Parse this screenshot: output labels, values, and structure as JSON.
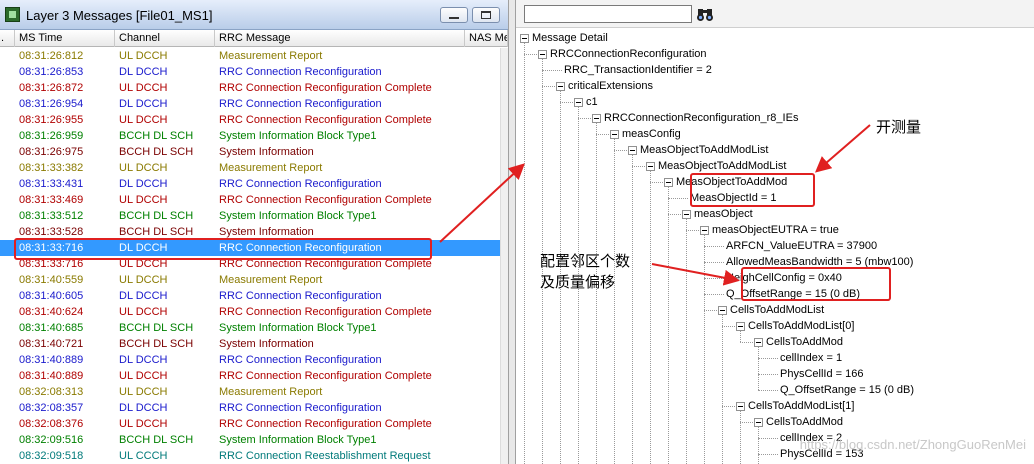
{
  "left_window": {
    "title": "Layer 3 Messages [File01_MS1]",
    "columns": [
      ".",
      "MS Time",
      "Channel",
      "RRC Message",
      "NAS Mes"
    ],
    "rows": [
      {
        "time": "08:31:26:812",
        "channel": "UL DCCH",
        "message": "Measurement Report",
        "color": "#8a7a00"
      },
      {
        "time": "08:31:26:853",
        "channel": "DL DCCH",
        "message": "RRC Connection Reconfiguration",
        "color": "#1a1acc"
      },
      {
        "time": "08:31:26:872",
        "channel": "UL DCCH",
        "message": "RRC Connection Reconfiguration Complete",
        "color": "#b00000"
      },
      {
        "time": "08:31:26:954",
        "channel": "DL DCCH",
        "message": "RRC Connection Reconfiguration",
        "color": "#1a1acc"
      },
      {
        "time": "08:31:26:955",
        "channel": "UL DCCH",
        "message": "RRC Connection Reconfiguration Complete",
        "color": "#b00000"
      },
      {
        "time": "08:31:26:959",
        "channel": "BCCH DL SCH",
        "message": "System Information Block Type1",
        "color": "#008000"
      },
      {
        "time": "08:31:26:975",
        "channel": "BCCH DL SCH",
        "message": "System Information",
        "color": "#7a0000"
      },
      {
        "time": "08:31:33:382",
        "channel": "UL DCCH",
        "message": "Measurement Report",
        "color": "#8a7a00"
      },
      {
        "time": "08:31:33:431",
        "channel": "DL DCCH",
        "message": "RRC Connection Reconfiguration",
        "color": "#1a1acc"
      },
      {
        "time": "08:31:33:469",
        "channel": "UL DCCH",
        "message": "RRC Connection Reconfiguration Complete",
        "color": "#b00000"
      },
      {
        "time": "08:31:33:512",
        "channel": "BCCH DL SCH",
        "message": "System Information Block Type1",
        "color": "#008000"
      },
      {
        "time": "08:31:33:528",
        "channel": "BCCH DL SCH",
        "message": "System Information",
        "color": "#7a0000"
      },
      {
        "time": "08:31:33:716",
        "channel": "DL DCCH",
        "message": "RRC Connection Reconfiguration",
        "color": "#1a1acc",
        "selected": true
      },
      {
        "time": "08:31:33:716",
        "channel": "UL DCCH",
        "message": "RRC Connection Reconfiguration Complete",
        "color": "#b00000"
      },
      {
        "time": "08:31:40:559",
        "channel": "UL DCCH",
        "message": "Measurement Report",
        "color": "#8a7a00"
      },
      {
        "time": "08:31:40:605",
        "channel": "DL DCCH",
        "message": "RRC Connection Reconfiguration",
        "color": "#1a1acc"
      },
      {
        "time": "08:31:40:624",
        "channel": "UL DCCH",
        "message": "RRC Connection Reconfiguration Complete",
        "color": "#b00000"
      },
      {
        "time": "08:31:40:685",
        "channel": "BCCH DL SCH",
        "message": "System Information Block Type1",
        "color": "#008000"
      },
      {
        "time": "08:31:40:721",
        "channel": "BCCH DL SCH",
        "message": "System Information",
        "color": "#7a0000"
      },
      {
        "time": "08:31:40:889",
        "channel": "DL DCCH",
        "message": "RRC Connection Reconfiguration",
        "color": "#1a1acc"
      },
      {
        "time": "08:31:40:889",
        "channel": "UL DCCH",
        "message": "RRC Connection Reconfiguration Complete",
        "color": "#b00000"
      },
      {
        "time": "08:32:08:313",
        "channel": "UL DCCH",
        "message": "Measurement Report",
        "color": "#8a7a00"
      },
      {
        "time": "08:32:08:357",
        "channel": "DL DCCH",
        "message": "RRC Connection Reconfiguration",
        "color": "#1a1acc"
      },
      {
        "time": "08:32:08:376",
        "channel": "UL DCCH",
        "message": "RRC Connection Reconfiguration Complete",
        "color": "#b00000"
      },
      {
        "time": "08:32:09:516",
        "channel": "BCCH DL SCH",
        "message": "System Information Block Type1",
        "color": "#008000"
      },
      {
        "time": "08:32:09:518",
        "channel": "UL CCCH",
        "message": "RRC Connection Reestablishment Request",
        "color": "#007a7a"
      }
    ]
  },
  "right_window": {
    "search_value": "",
    "find_icon": "binoculars-icon",
    "tree": [
      {
        "text": "Message Detail",
        "level": 0
      },
      {
        "text": "RRCConnectionReconfiguration",
        "level": 1
      },
      {
        "text": "RRC_TransactionIdentifier = 2",
        "level": 2
      },
      {
        "text": "criticalExtensions",
        "level": 2
      },
      {
        "text": "c1",
        "level": 3
      },
      {
        "text": "RRCConnectionReconfiguration_r8_IEs",
        "level": 4
      },
      {
        "text": "measConfig",
        "level": 5
      },
      {
        "text": "MeasObjectToAddModList",
        "level": 6
      },
      {
        "text": "MeasObjectToAddModList",
        "level": 7
      },
      {
        "text": "MeasObjectToAddMod",
        "level": 8
      },
      {
        "text": "MeasObjectId = 1",
        "level": 9
      },
      {
        "text": "measObject",
        "level": 9
      },
      {
        "text": "measObjectEUTRA = true",
        "level": 10
      },
      {
        "text": "ARFCN_ValueEUTRA = 37900",
        "level": 11
      },
      {
        "text": "AllowedMeasBandwidth = 5 (mbw100)",
        "level": 11
      },
      {
        "text": "NeighCellConfig = 0x40",
        "level": 11
      },
      {
        "text": "Q_OffsetRange = 15 (0 dB)",
        "level": 11
      },
      {
        "text": "CellsToAddModList",
        "level": 11
      },
      {
        "text": "CellsToAddModList[0]",
        "level": 12
      },
      {
        "text": "CellsToAddMod",
        "level": 13
      },
      {
        "text": "cellIndex = 1",
        "level": 14
      },
      {
        "text": "PhysCellId = 166",
        "level": 14
      },
      {
        "text": "Q_OffsetRange = 15 (0 dB)",
        "level": 14
      },
      {
        "text": "CellsToAddModList[1]",
        "level": 12
      },
      {
        "text": "CellsToAddMod",
        "level": 13
      },
      {
        "text": "cellIndex = 2",
        "level": 14
      },
      {
        "text": "PhysCellId = 153",
        "level": 14
      }
    ]
  },
  "annotations": {
    "start_measure": "开测量",
    "config_line1": "配置邻区个数",
    "config_line2": "及质量偏移",
    "watermark": "https://blog.csdn.net/ZhongGuoRenMei",
    "color": "#e02020"
  }
}
